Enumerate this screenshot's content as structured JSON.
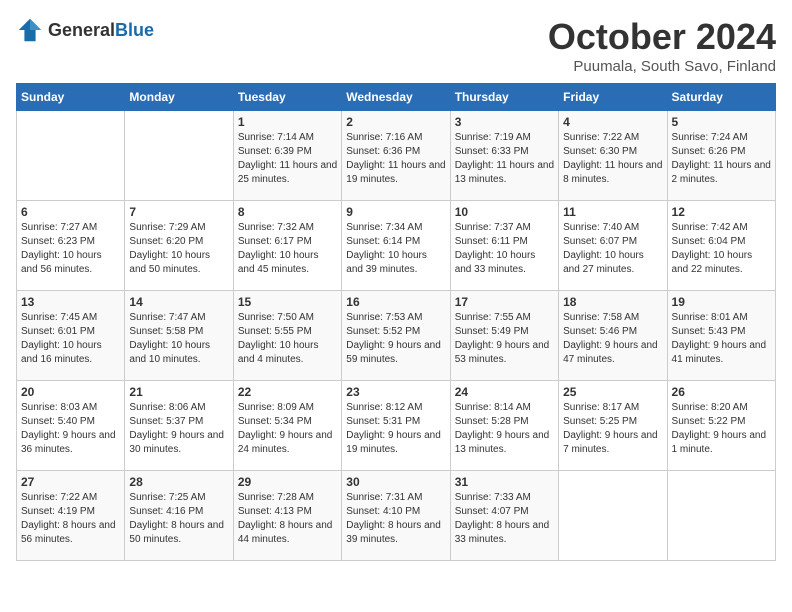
{
  "logo": {
    "general": "General",
    "blue": "Blue"
  },
  "header": {
    "month": "October 2024",
    "location": "Puumala, South Savo, Finland"
  },
  "weekdays": [
    "Sunday",
    "Monday",
    "Tuesday",
    "Wednesday",
    "Thursday",
    "Friday",
    "Saturday"
  ],
  "weeks": [
    [
      {
        "day": "",
        "info": ""
      },
      {
        "day": "",
        "info": ""
      },
      {
        "day": "1",
        "info": "Sunrise: 7:14 AM\nSunset: 6:39 PM\nDaylight: 11 hours and 25 minutes."
      },
      {
        "day": "2",
        "info": "Sunrise: 7:16 AM\nSunset: 6:36 PM\nDaylight: 11 hours and 19 minutes."
      },
      {
        "day": "3",
        "info": "Sunrise: 7:19 AM\nSunset: 6:33 PM\nDaylight: 11 hours and 13 minutes."
      },
      {
        "day": "4",
        "info": "Sunrise: 7:22 AM\nSunset: 6:30 PM\nDaylight: 11 hours and 8 minutes."
      },
      {
        "day": "5",
        "info": "Sunrise: 7:24 AM\nSunset: 6:26 PM\nDaylight: 11 hours and 2 minutes."
      }
    ],
    [
      {
        "day": "6",
        "info": "Sunrise: 7:27 AM\nSunset: 6:23 PM\nDaylight: 10 hours and 56 minutes."
      },
      {
        "day": "7",
        "info": "Sunrise: 7:29 AM\nSunset: 6:20 PM\nDaylight: 10 hours and 50 minutes."
      },
      {
        "day": "8",
        "info": "Sunrise: 7:32 AM\nSunset: 6:17 PM\nDaylight: 10 hours and 45 minutes."
      },
      {
        "day": "9",
        "info": "Sunrise: 7:34 AM\nSunset: 6:14 PM\nDaylight: 10 hours and 39 minutes."
      },
      {
        "day": "10",
        "info": "Sunrise: 7:37 AM\nSunset: 6:11 PM\nDaylight: 10 hours and 33 minutes."
      },
      {
        "day": "11",
        "info": "Sunrise: 7:40 AM\nSunset: 6:07 PM\nDaylight: 10 hours and 27 minutes."
      },
      {
        "day": "12",
        "info": "Sunrise: 7:42 AM\nSunset: 6:04 PM\nDaylight: 10 hours and 22 minutes."
      }
    ],
    [
      {
        "day": "13",
        "info": "Sunrise: 7:45 AM\nSunset: 6:01 PM\nDaylight: 10 hours and 16 minutes."
      },
      {
        "day": "14",
        "info": "Sunrise: 7:47 AM\nSunset: 5:58 PM\nDaylight: 10 hours and 10 minutes."
      },
      {
        "day": "15",
        "info": "Sunrise: 7:50 AM\nSunset: 5:55 PM\nDaylight: 10 hours and 4 minutes."
      },
      {
        "day": "16",
        "info": "Sunrise: 7:53 AM\nSunset: 5:52 PM\nDaylight: 9 hours and 59 minutes."
      },
      {
        "day": "17",
        "info": "Sunrise: 7:55 AM\nSunset: 5:49 PM\nDaylight: 9 hours and 53 minutes."
      },
      {
        "day": "18",
        "info": "Sunrise: 7:58 AM\nSunset: 5:46 PM\nDaylight: 9 hours and 47 minutes."
      },
      {
        "day": "19",
        "info": "Sunrise: 8:01 AM\nSunset: 5:43 PM\nDaylight: 9 hours and 41 minutes."
      }
    ],
    [
      {
        "day": "20",
        "info": "Sunrise: 8:03 AM\nSunset: 5:40 PM\nDaylight: 9 hours and 36 minutes."
      },
      {
        "day": "21",
        "info": "Sunrise: 8:06 AM\nSunset: 5:37 PM\nDaylight: 9 hours and 30 minutes."
      },
      {
        "day": "22",
        "info": "Sunrise: 8:09 AM\nSunset: 5:34 PM\nDaylight: 9 hours and 24 minutes."
      },
      {
        "day": "23",
        "info": "Sunrise: 8:12 AM\nSunset: 5:31 PM\nDaylight: 9 hours and 19 minutes."
      },
      {
        "day": "24",
        "info": "Sunrise: 8:14 AM\nSunset: 5:28 PM\nDaylight: 9 hours and 13 minutes."
      },
      {
        "day": "25",
        "info": "Sunrise: 8:17 AM\nSunset: 5:25 PM\nDaylight: 9 hours and 7 minutes."
      },
      {
        "day": "26",
        "info": "Sunrise: 8:20 AM\nSunset: 5:22 PM\nDaylight: 9 hours and 1 minute."
      }
    ],
    [
      {
        "day": "27",
        "info": "Sunrise: 7:22 AM\nSunset: 4:19 PM\nDaylight: 8 hours and 56 minutes."
      },
      {
        "day": "28",
        "info": "Sunrise: 7:25 AM\nSunset: 4:16 PM\nDaylight: 8 hours and 50 minutes."
      },
      {
        "day": "29",
        "info": "Sunrise: 7:28 AM\nSunset: 4:13 PM\nDaylight: 8 hours and 44 minutes."
      },
      {
        "day": "30",
        "info": "Sunrise: 7:31 AM\nSunset: 4:10 PM\nDaylight: 8 hours and 39 minutes."
      },
      {
        "day": "31",
        "info": "Sunrise: 7:33 AM\nSunset: 4:07 PM\nDaylight: 8 hours and 33 minutes."
      },
      {
        "day": "",
        "info": ""
      },
      {
        "day": "",
        "info": ""
      }
    ]
  ]
}
